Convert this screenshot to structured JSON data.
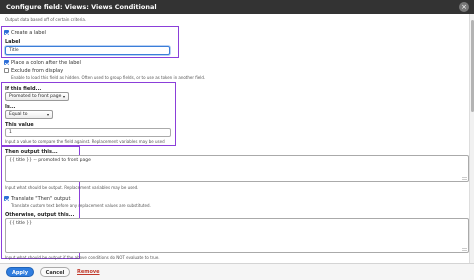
{
  "dialog": {
    "title": "Configure field: Views: Views Conditional",
    "close_glyph": "×"
  },
  "intro": "Output data based off of certain criteria.",
  "create_label": {
    "checked": true,
    "text": "Create a label"
  },
  "label_field": {
    "label": "Label",
    "value": "Title"
  },
  "place_colon": {
    "checked": true,
    "text": "Place a colon after the label"
  },
  "exclude": {
    "checked": false,
    "text": "Exclude from display",
    "description": "Enable to load this field as hidden. Often used to group fields, or to use as token in another field."
  },
  "if_field": {
    "label": "If this field...",
    "value": "Promoted to front page"
  },
  "is": {
    "label": "Is...",
    "value": "Equal to"
  },
  "this_value": {
    "label": "This value",
    "value": "1",
    "description": "Input a value to compare the field against. Replacement variables may be used"
  },
  "then_output": {
    "label": "Then output this...",
    "value": "{{ title }} -- promoted to front page",
    "description": "Input what should be output. Replacement variables may be used."
  },
  "translate": {
    "checked": true,
    "text": "Translate \"Then\" output",
    "description": "Translate custom text before any replacement values are substituted."
  },
  "otherwise": {
    "label": "Otherwise, output this...",
    "value": "{{ title }}",
    "description": "Input what should be output if the above conditions do NOT evaluate to true."
  },
  "footer": {
    "apply": "Apply",
    "cancel": "Cancel",
    "remove": "Remove"
  },
  "colors": {
    "highlight": "#8b3fd9",
    "primary_button": "#2f7ddf",
    "remove_link": "#c0392b"
  },
  "icons": {
    "close": "close-icon",
    "dropdown": "chevron-down-icon"
  }
}
